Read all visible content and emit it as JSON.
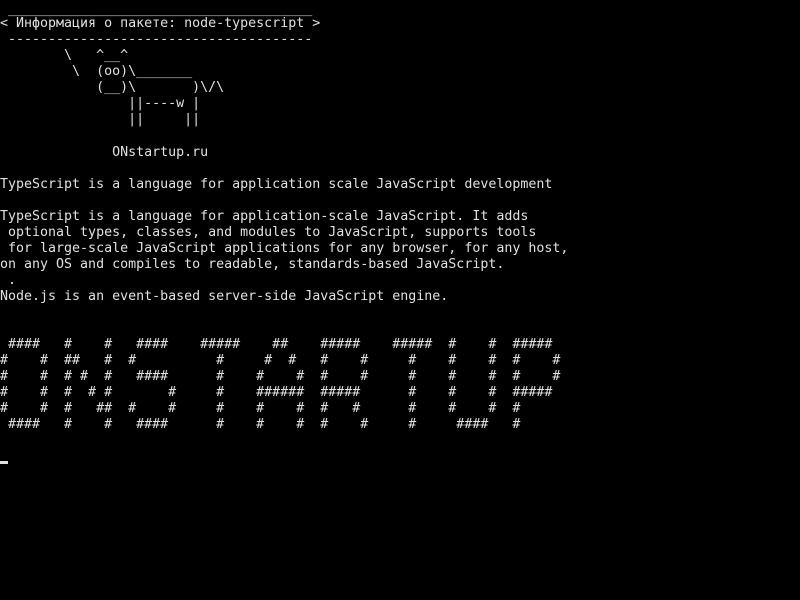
{
  "colors": {
    "background": "#000000",
    "foreground": "#e0e0e0"
  },
  "cowsay": {
    "border_top": " ______________________________________",
    "message": "< Информация о пакете: node-typescript >",
    "border_bottom": " --------------------------------------",
    "cow": [
      "        \\   ^__^",
      "         \\  (oo)\\_______",
      "            (__)\\       )\\/\\",
      "                ||----w |",
      "                ||     ||"
    ]
  },
  "site_label": "              ONstartup.ru",
  "package_summary": "TypeScript is a language for application scale JavaScript development",
  "package_description": [
    "TypeScript is a language for application-scale JavaScript. It adds",
    " optional types, classes, and modules to JavaScript, supports tools",
    " for large-scale JavaScript applications for any browser, for any host,",
    "on any OS and compiles to readable, standards-based JavaScript.",
    " .",
    "Node.js is an event-based server-side JavaScript engine."
  ],
  "banner": [
    " ####   #    #   ####    #####    ##    #####    #####  #    #  #####",
    "#    #  ##   #  #          #     #  #   #    #     #    #    #  #    #",
    "#    #  # #  #   ####      #    #    #  #    #     #    #    #  #    #",
    "#    #  #  # #       #     #    ######  #####      #    #    #  #####",
    "#    #  #   ##  #    #     #    #    #  #   #      #    #    #  #",
    " ####   #    #   ####      #    #    #  #    #     #     ####   #"
  ]
}
